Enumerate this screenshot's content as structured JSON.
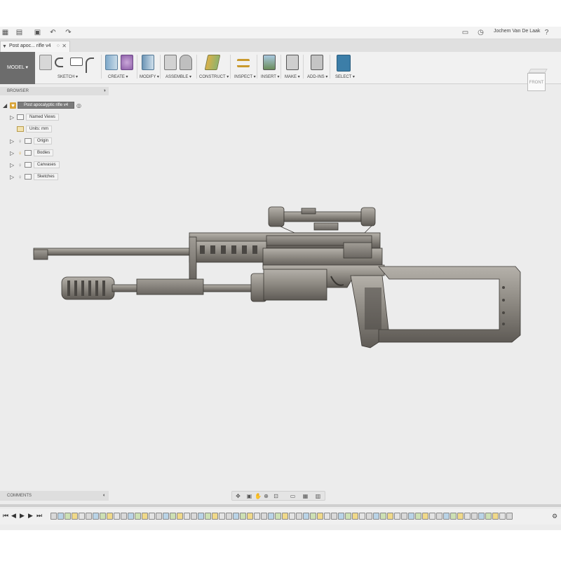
{
  "top_bar": {
    "user_name": "Jochem Van De Laak",
    "icons": [
      "grid-icon",
      "file-icon",
      "save-icon",
      "undo-icon",
      "redo-icon",
      "notification-icon",
      "clock-icon",
      "help-icon"
    ]
  },
  "tab": {
    "title": "Post apoc... rifle v4",
    "close": "✕"
  },
  "toolbar": {
    "model_label": "MODEL ▾",
    "groups": [
      {
        "label": "SKETCH ▾"
      },
      {
        "label": "CREATE ▾"
      },
      {
        "label": "MODIFY ▾"
      },
      {
        "label": "ASSEMBLE ▾"
      },
      {
        "label": "CONSTRUCT ▾"
      },
      {
        "label": "INSPECT ▾"
      },
      {
        "label": "INSERT ▾"
      },
      {
        "label": "MAKE ▾"
      },
      {
        "label": "ADD-INS ▾"
      },
      {
        "label": "SELECT ▾"
      }
    ]
  },
  "viewcube": {
    "face": "FRONT"
  },
  "browser": {
    "header": "BROWSER",
    "root": "Post apocalyptic rifle v4",
    "nodes": [
      {
        "label": "Named Views"
      },
      {
        "label": "Units: mm"
      },
      {
        "label": "Origin"
      },
      {
        "label": "Bodies"
      },
      {
        "label": "Canvases"
      },
      {
        "label": "Sketches"
      }
    ]
  },
  "comments": {
    "label": "COMMENTS"
  },
  "colors": {
    "toolbar_bg": "#f1f1f1",
    "canvas_bg": "#ececec",
    "model_body": "#8a8680",
    "model_dark": "#4a4743",
    "accent_select": "#3c7ea8"
  }
}
